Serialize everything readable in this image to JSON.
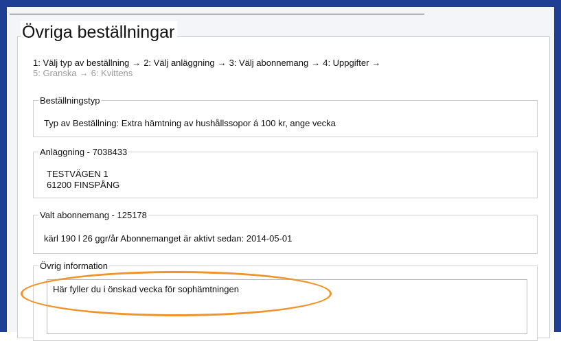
{
  "page": {
    "title": "Övriga beställningar"
  },
  "steps": {
    "row1": [
      {
        "label": "1: Välj typ av beställning"
      },
      {
        "label": "2: Välj anläggning"
      },
      {
        "label": "3: Välj abonnemang"
      },
      {
        "label": "4: Uppgifter"
      }
    ],
    "row2": [
      {
        "label": "5: Granska"
      },
      {
        "label": "6: Kvittens"
      }
    ],
    "arrow": "→"
  },
  "order_type": {
    "legend": "Beställningstyp",
    "text": "Typ av Beställning: Extra hämtning av hushållssopor á 100 kr, ange vecka"
  },
  "facility": {
    "legend": "Anläggning - 7038433",
    "address_line1": "TESTVÄGEN 1",
    "address_line2": "61200 FINSPÅNG"
  },
  "subscription": {
    "legend": "Valt abonnemang - 125178",
    "text": "kärl 190 l 26 ggr/år Abonnemanget är aktivt sedan: 2014-05-01"
  },
  "other_info": {
    "legend": "Övrig information",
    "textarea_value": "Här fyller du i önskad vecka för sophämtningen"
  },
  "colors": {
    "window_border": "#1f3f95",
    "highlight": "#f0932a",
    "inactive_step": "#9a9a9a"
  }
}
